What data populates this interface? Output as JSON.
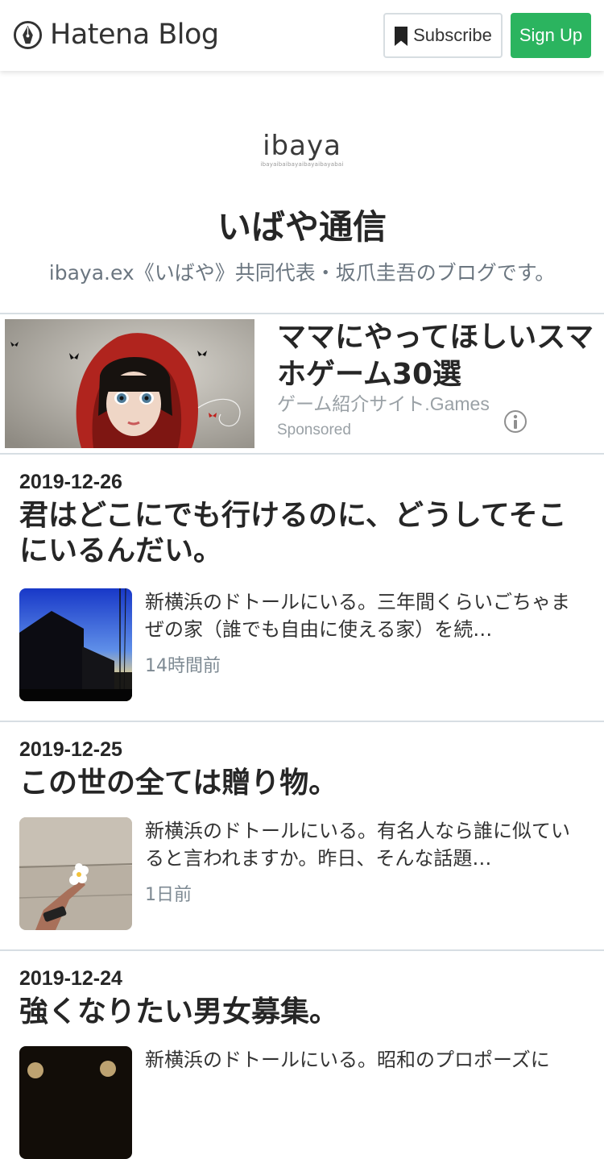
{
  "topbar": {
    "brand": "Hatena Blog",
    "subscribe_label": "Subscribe",
    "signup_label": "Sign Up",
    "signup_color": "#2bb45f"
  },
  "blog": {
    "logo_word": "ibaya",
    "logo_sub": "ibayaibaibayaibayaibayabai",
    "title": "いばや通信",
    "description": "ibaya.ex《いばや》共同代表・坂爪圭吾のブログです。"
  },
  "ad": {
    "title": "ママにやってほしいスマホゲーム30選",
    "source": "ゲーム紹介サイト.Games",
    "sponsored": "Sponsored",
    "info_icon": "info-icon"
  },
  "entries": [
    {
      "date": "2019-12-26",
      "title": "君はどこにでも行けるのに、どうしてそこにいるんだい。",
      "summary": "新横浜のドトールにいる。三年間くらいごちゃまぜの家（誰でも自由に使える家）を続…",
      "time": "14時間前"
    },
    {
      "date": "2019-12-25",
      "title": "この世の全ては贈り物。",
      "summary": "新横浜のドトールにいる。有名人なら誰に似ていると言われますか。昨日、そんな話題…",
      "time": "1日前"
    },
    {
      "date": "2019-12-24",
      "title": "強くなりたい男女募集。",
      "summary": "新横浜のドトールにいる。昭和のプロポーズに",
      "time": ""
    }
  ]
}
